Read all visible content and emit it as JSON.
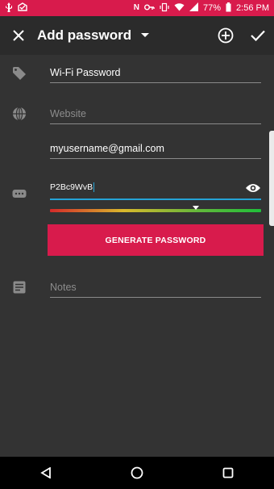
{
  "status_bar": {
    "battery_percent": "77%",
    "time": "2:56 PM",
    "left_icons": [
      "usb-icon",
      "notification-icon"
    ],
    "right_icons": [
      "nfc-icon",
      "key-icon",
      "vibrate-icon",
      "wifi-icon",
      "signal-icon",
      "battery-icon"
    ]
  },
  "toolbar": {
    "title": "Add password",
    "close_icon": "close-icon",
    "dropdown_icon": "dropdown-icon",
    "add_icon": "add-circle-icon",
    "confirm_icon": "check-icon"
  },
  "form": {
    "name": {
      "value": "Wi-Fi Password",
      "icon": "tag-icon"
    },
    "website": {
      "placeholder": "Website",
      "icon": "globe-icon"
    },
    "username": {
      "value": "myusername@gmail.com"
    },
    "password": {
      "value": "P2Bc9WvB",
      "icon": "password-icon",
      "visibility_icon": "eye-icon"
    },
    "strength": {
      "level": 0.69
    },
    "generate_button": "GENERATE PASSWORD",
    "notes": {
      "placeholder": "Notes",
      "icon": "notes-icon"
    }
  },
  "nav_bar": {
    "back_icon": "back-icon",
    "home_icon": "home-icon",
    "recents_icon": "recents-icon"
  },
  "colors": {
    "accent": "#d81b4c",
    "focus": "#25a3d6",
    "background": "#333333",
    "toolbar": "#2b2b2b"
  }
}
